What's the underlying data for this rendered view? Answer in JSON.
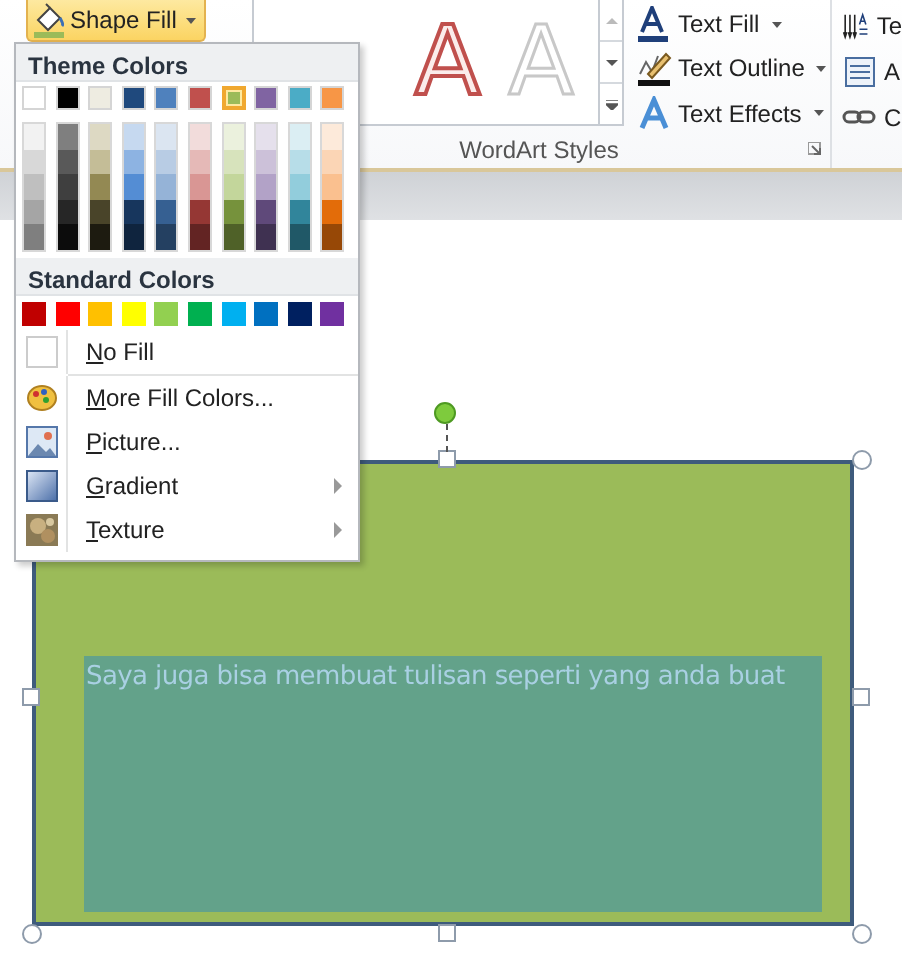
{
  "ribbon": {
    "shape_fill": {
      "label": "Shape Fill",
      "open": true
    },
    "wordart_gallery": [
      {
        "letter": "A",
        "kind": "outline-red"
      },
      {
        "letter": "A",
        "kind": "outline-white"
      }
    ],
    "wordart_group_label": "WordArt Styles",
    "text_buttons": [
      {
        "label": "Text Fill",
        "kind": "fill"
      },
      {
        "label": "Text Outline",
        "kind": "outline"
      },
      {
        "label": "Text Effects",
        "kind": "effects"
      }
    ],
    "next_group": [
      {
        "label": "Te",
        "kind": "direction"
      },
      {
        "label": "A",
        "kind": "align"
      },
      {
        "label": "C",
        "kind": "link"
      }
    ]
  },
  "menu": {
    "theme_header": "Theme Colors",
    "theme_colors": [
      {
        "color": "#ffffff",
        "selected": false,
        "shades": [
          {
            "color": "#f2f2f2"
          },
          {
            "color": "#d8d8d8"
          },
          {
            "color": "#bfbfbf"
          },
          {
            "color": "#a5a5a5"
          },
          {
            "color": "#7f7f7f"
          }
        ]
      },
      {
        "color": "#000000",
        "selected": false,
        "shades": [
          {
            "color": "#7f7f7f"
          },
          {
            "color": "#595959"
          },
          {
            "color": "#3f3f3f"
          },
          {
            "color": "#262626"
          },
          {
            "color": "#0c0c0c"
          }
        ]
      },
      {
        "color": "#eeece1",
        "selected": false,
        "shades": [
          {
            "color": "#ddd9c3"
          },
          {
            "color": "#c4bd97"
          },
          {
            "color": "#938953"
          },
          {
            "color": "#494429"
          },
          {
            "color": "#1d1b10"
          }
        ]
      },
      {
        "color": "#1f497d",
        "selected": false,
        "shades": [
          {
            "color": "#c6d9f0"
          },
          {
            "color": "#8db3e2"
          },
          {
            "color": "#548dd4"
          },
          {
            "color": "#17365d"
          },
          {
            "color": "#0f243e"
          }
        ]
      },
      {
        "color": "#4f81bd",
        "selected": false,
        "shades": [
          {
            "color": "#dbe5f1"
          },
          {
            "color": "#b8cce4"
          },
          {
            "color": "#95b3d7"
          },
          {
            "color": "#366092"
          },
          {
            "color": "#244061"
          }
        ]
      },
      {
        "color": "#c0504d",
        "selected": false,
        "shades": [
          {
            "color": "#f2dcdb"
          },
          {
            "color": "#e5b9b7"
          },
          {
            "color": "#d99694"
          },
          {
            "color": "#953734"
          },
          {
            "color": "#632423"
          }
        ]
      },
      {
        "color": "#9bbb59",
        "selected": true,
        "shades": [
          {
            "color": "#ebf1dd"
          },
          {
            "color": "#d7e3bc"
          },
          {
            "color": "#c3d69b"
          },
          {
            "color": "#76923c"
          },
          {
            "color": "#4f6128"
          }
        ]
      },
      {
        "color": "#8064a2",
        "selected": false,
        "shades": [
          {
            "color": "#e5e0ec"
          },
          {
            "color": "#ccc1d9"
          },
          {
            "color": "#b2a2c7"
          },
          {
            "color": "#5f497a"
          },
          {
            "color": "#3f3151"
          }
        ]
      },
      {
        "color": "#4bacc6",
        "selected": false,
        "shades": [
          {
            "color": "#dbeef3"
          },
          {
            "color": "#b7dde8"
          },
          {
            "color": "#92cddc"
          },
          {
            "color": "#31859b"
          },
          {
            "color": "#205867"
          }
        ]
      },
      {
        "color": "#f79646",
        "selected": false,
        "shades": [
          {
            "color": "#fdeada"
          },
          {
            "color": "#fbd5b5"
          },
          {
            "color": "#fac08f"
          },
          {
            "color": "#e36c09"
          },
          {
            "color": "#974806"
          }
        ]
      }
    ],
    "standard_header": "Standard Colors",
    "standard_colors": [
      {
        "color": "#c00000"
      },
      {
        "color": "#ff0000"
      },
      {
        "color": "#ffc000"
      },
      {
        "color": "#ffff00"
      },
      {
        "color": "#92d050"
      },
      {
        "color": "#00b050"
      },
      {
        "color": "#00b0f0"
      },
      {
        "color": "#0070c0"
      },
      {
        "color": "#002060"
      },
      {
        "color": "#7030a0"
      }
    ],
    "items": [
      {
        "label": "No Fill",
        "kind": "no-fill",
        "submenu": false
      },
      {
        "label": "More Fill Colors...",
        "kind": "palette",
        "submenu": false
      },
      {
        "label": "Picture...",
        "kind": "picture",
        "submenu": false
      },
      {
        "label": "Gradient",
        "kind": "gradient",
        "submenu": true
      },
      {
        "label": "Texture",
        "kind": "texture",
        "submenu": true
      }
    ]
  },
  "canvas": {
    "shape_text": "Saya juga bisa membuat tulisan seperti yang anda buat",
    "selected": true
  }
}
